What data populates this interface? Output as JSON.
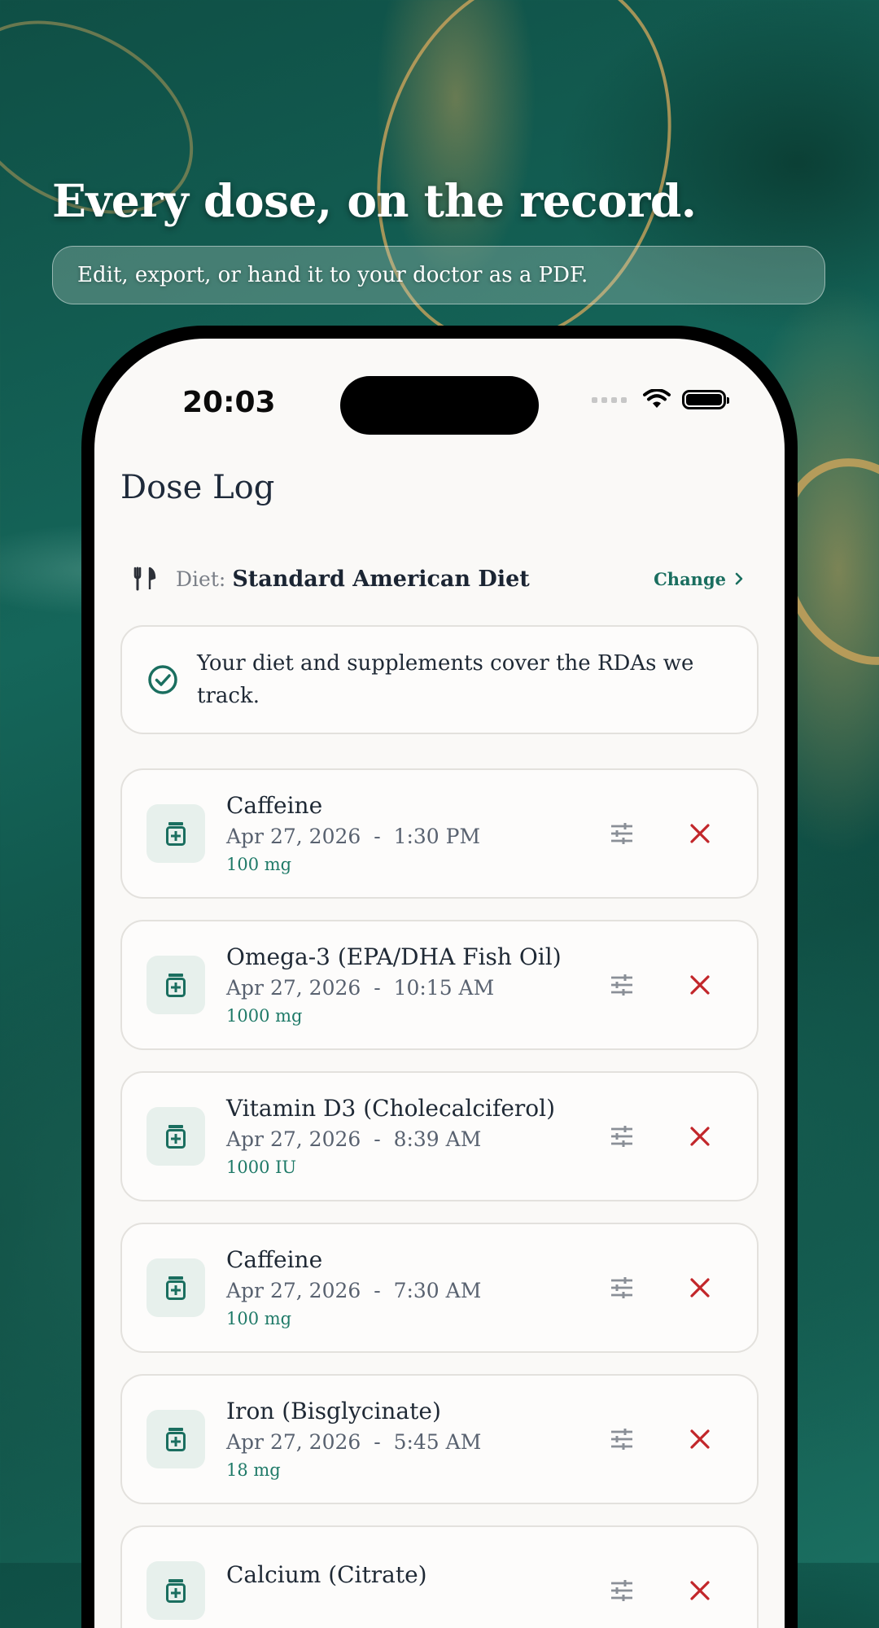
{
  "marketing": {
    "headline": "Every dose, on the record.",
    "subline": "Edit, export, or hand it to your doctor as a PDF."
  },
  "status_bar": {
    "time": "20:03"
  },
  "page": {
    "title": "Dose Log"
  },
  "diet": {
    "icon": "fork-knife-icon",
    "label": "Diet:",
    "value": "Standard American Diet",
    "change_label": "Change"
  },
  "notice": {
    "icon": "check-circle-icon",
    "text": "Your diet and supplements cover the RDAs we track."
  },
  "colors": {
    "accent": "#1a6e5f",
    "delete": "#c2262a",
    "badge_bg": "#e7f0ec",
    "background_green": "#15665a",
    "gold": "#d6a85c"
  },
  "doses": [
    {
      "name": "Caffeine",
      "date": "Apr 27, 2026",
      "time": "1:30 PM",
      "amount": "100 mg",
      "separator": "-"
    },
    {
      "name": "Omega-3 (EPA/DHA Fish Oil)",
      "date": "Apr 27, 2026",
      "time": "10:15 AM",
      "amount": "1000 mg",
      "separator": "-"
    },
    {
      "name": "Vitamin D3 (Cholecalciferol)",
      "date": "Apr 27, 2026",
      "time": "8:39 AM",
      "amount": "1000 IU",
      "separator": "-"
    },
    {
      "name": "Caffeine",
      "date": "Apr 27, 2026",
      "time": "7:30 AM",
      "amount": "100 mg",
      "separator": "-"
    },
    {
      "name": "Iron (Bisglycinate)",
      "date": "Apr 27, 2026",
      "time": "5:45 AM",
      "amount": "18 mg",
      "separator": "-"
    },
    {
      "name": "Calcium (Citrate)",
      "date": "",
      "time": "",
      "amount": "",
      "separator": ""
    }
  ]
}
